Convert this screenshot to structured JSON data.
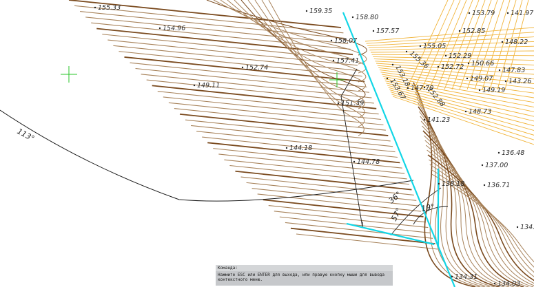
{
  "colors": {
    "contour_brown": "#7a4a1e",
    "contour_light_brown": "#a7825a",
    "contour_yellow": "#f1b43a",
    "cyan_line": "#12d6e6",
    "crosshair_green": "#27c427",
    "arc_black": "#1a1a1a"
  },
  "elevations": [
    {
      "id": "e1",
      "text": "155.33"
    },
    {
      "id": "e2",
      "text": "154.96"
    },
    {
      "id": "e3",
      "text": "152.74"
    },
    {
      "id": "e4",
      "text": "149.11"
    },
    {
      "id": "e5",
      "text": "144.18"
    },
    {
      "id": "e6",
      "text": "144.78"
    },
    {
      "id": "e7",
      "text": "151.39"
    },
    {
      "id": "e8",
      "text": "157.41"
    },
    {
      "id": "e9",
      "text": "159.35"
    },
    {
      "id": "e10",
      "text": "158.80"
    },
    {
      "id": "e11",
      "text": "157.57"
    },
    {
      "id": "e12",
      "text": "158.07"
    },
    {
      "id": "e13",
      "text": "153.79"
    },
    {
      "id": "e14",
      "text": "141.97"
    },
    {
      "id": "e15",
      "text": "152.85"
    },
    {
      "id": "e16",
      "text": "155.05"
    },
    {
      "id": "e17",
      "text": "155.36"
    },
    {
      "id": "e18",
      "text": "152.29"
    },
    {
      "id": "e19",
      "text": "148.22"
    },
    {
      "id": "e20",
      "text": "150.66"
    },
    {
      "id": "e21",
      "text": "152.72"
    },
    {
      "id": "e22",
      "text": "147.83"
    },
    {
      "id": "e23",
      "text": "153.18"
    },
    {
      "id": "e24",
      "text": "149.07"
    },
    {
      "id": "e25",
      "text": "143.26"
    },
    {
      "id": "e26",
      "text": "153.67"
    },
    {
      "id": "e27",
      "text": "147.70"
    },
    {
      "id": "e28",
      "text": "152.88"
    },
    {
      "id": "e29",
      "text": "149.19"
    },
    {
      "id": "e30",
      "text": "148.73"
    },
    {
      "id": "e31",
      "text": "141.23"
    },
    {
      "id": "e32",
      "text": "136.48"
    },
    {
      "id": "e33",
      "text": "137.00"
    },
    {
      "id": "e34",
      "text": "138.18"
    },
    {
      "id": "e35",
      "text": "136.71"
    },
    {
      "id": "e36",
      "text": "134.8"
    },
    {
      "id": "e37",
      "text": "134.31"
    },
    {
      "id": "e38",
      "text": "134.03"
    }
  ],
  "angles": [
    {
      "id": "a1",
      "text": "113°"
    },
    {
      "id": "a2",
      "text": "36°"
    },
    {
      "id": "a3",
      "text": "19°"
    },
    {
      "id": "a4",
      "text": "57°"
    }
  ],
  "command": {
    "header": "Команда:",
    "line1": "Нажмите ESC или ENTER для выхода, или правую кнопку мыши для вывода",
    "line2": "контекстного меню."
  }
}
